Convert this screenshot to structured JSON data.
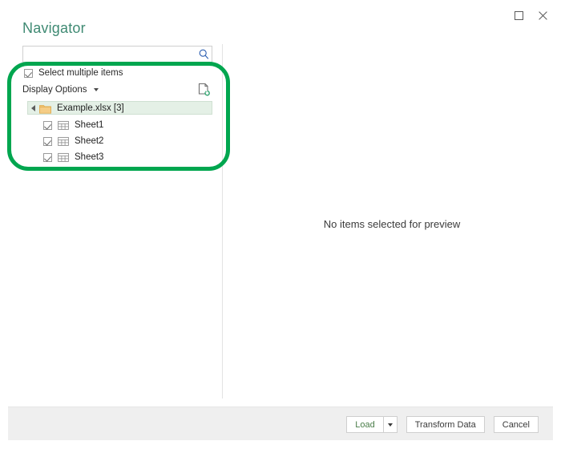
{
  "window": {
    "controls": [
      {
        "name": "maximize",
        "glyph": "square"
      },
      {
        "name": "close",
        "glyph": "x"
      }
    ]
  },
  "header": {
    "title": "Navigator"
  },
  "search": {
    "value": "",
    "placeholder": "",
    "icon": "search-icon"
  },
  "options": {
    "select_multiple_label": "Select multiple items",
    "select_multiple_checked": true,
    "display_options_label": "Display Options",
    "display_options_caret": "chevron-down-icon",
    "refresh_icon": "refresh-document-icon"
  },
  "tree": {
    "root": {
      "label": "Example.xlsx [3]",
      "icon": "folder-icon",
      "expanded": true,
      "selected": true
    },
    "children": [
      {
        "label": "Sheet1",
        "icon": "worksheet-icon",
        "checked": true
      },
      {
        "label": "Sheet2",
        "icon": "worksheet-icon",
        "checked": true
      },
      {
        "label": "Sheet3",
        "icon": "worksheet-icon",
        "checked": true
      }
    ]
  },
  "preview": {
    "empty_message": "No items selected for preview"
  },
  "footer": {
    "load_label": "Load",
    "load_caret": "chevron-down-icon",
    "transform_label": "Transform Data",
    "cancel_label": "Cancel"
  },
  "annotation": {
    "color": "#00a64f",
    "shape": "rounded-rectangle"
  },
  "colors": {
    "title": "#3f8a73",
    "selected_row_bg": "#e4f0e6",
    "footer_bg": "#efefef",
    "load_text": "#4a7d49",
    "search_icon": "#2a5db0"
  }
}
